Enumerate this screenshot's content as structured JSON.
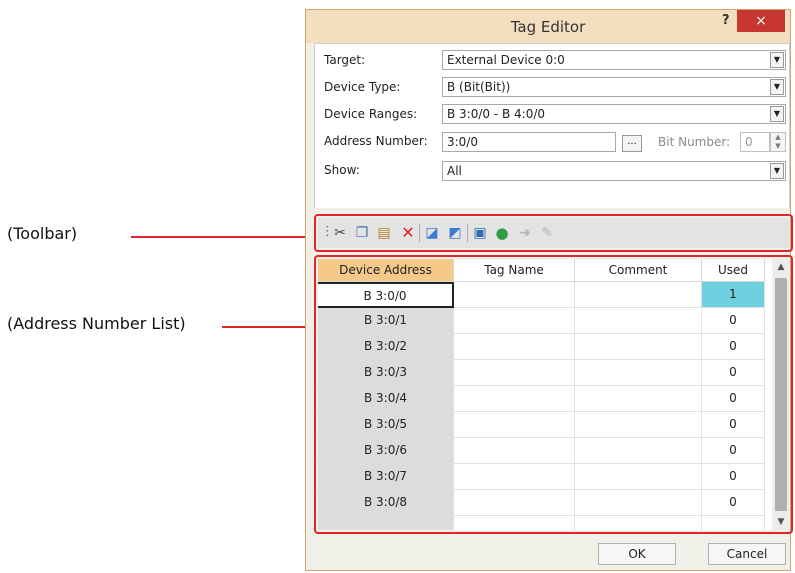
{
  "callouts": {
    "toolbar": "(Toolbar)",
    "list": "(Address Number List)"
  },
  "dialog": {
    "title": "Tag Editor",
    "help": "?",
    "close": "×"
  },
  "form": {
    "target_label": "Target:",
    "target_value": "External Device 0:0",
    "device_type_label": "Device Type:",
    "device_type_value": "B (Bit(Bit))",
    "device_ranges_label": "Device Ranges:",
    "device_ranges_value": "B 3:0/0 - B 4:0/0",
    "address_number_label": "Address Number:",
    "address_number_value": "3:0/0",
    "browse_label": "...",
    "bit_number_label": "Bit Number:",
    "bit_number_value": "0",
    "show_label": "Show:",
    "show_value": "All"
  },
  "toolbar": {
    "icons": [
      "cut-icon",
      "copy-icon",
      "paste-icon",
      "delete-icon",
      "import-icon",
      "export-icon",
      "copy-rows-icon",
      "refresh-icon",
      "forward-icon",
      "clear-icon"
    ]
  },
  "grid": {
    "columns": [
      "Device Address",
      "Tag Name",
      "Comment",
      "Used"
    ],
    "rows": [
      {
        "address": "B 3:0/0",
        "tag": "",
        "comment": "",
        "used": "1"
      },
      {
        "address": "B 3:0/1",
        "tag": "",
        "comment": "",
        "used": "0"
      },
      {
        "address": "B 3:0/2",
        "tag": "",
        "comment": "",
        "used": "0"
      },
      {
        "address": "B 3:0/3",
        "tag": "",
        "comment": "",
        "used": "0"
      },
      {
        "address": "B 3:0/4",
        "tag": "",
        "comment": "",
        "used": "0"
      },
      {
        "address": "B 3:0/5",
        "tag": "",
        "comment": "",
        "used": "0"
      },
      {
        "address": "B 3:0/6",
        "tag": "",
        "comment": "",
        "used": "0"
      },
      {
        "address": "B 3:0/7",
        "tag": "",
        "comment": "",
        "used": "0"
      },
      {
        "address": "B 3:0/8",
        "tag": "",
        "comment": "",
        "used": "0"
      }
    ],
    "highlight_color": "#6fd1df"
  },
  "buttons": {
    "ok": "OK",
    "cancel": "Cancel"
  }
}
